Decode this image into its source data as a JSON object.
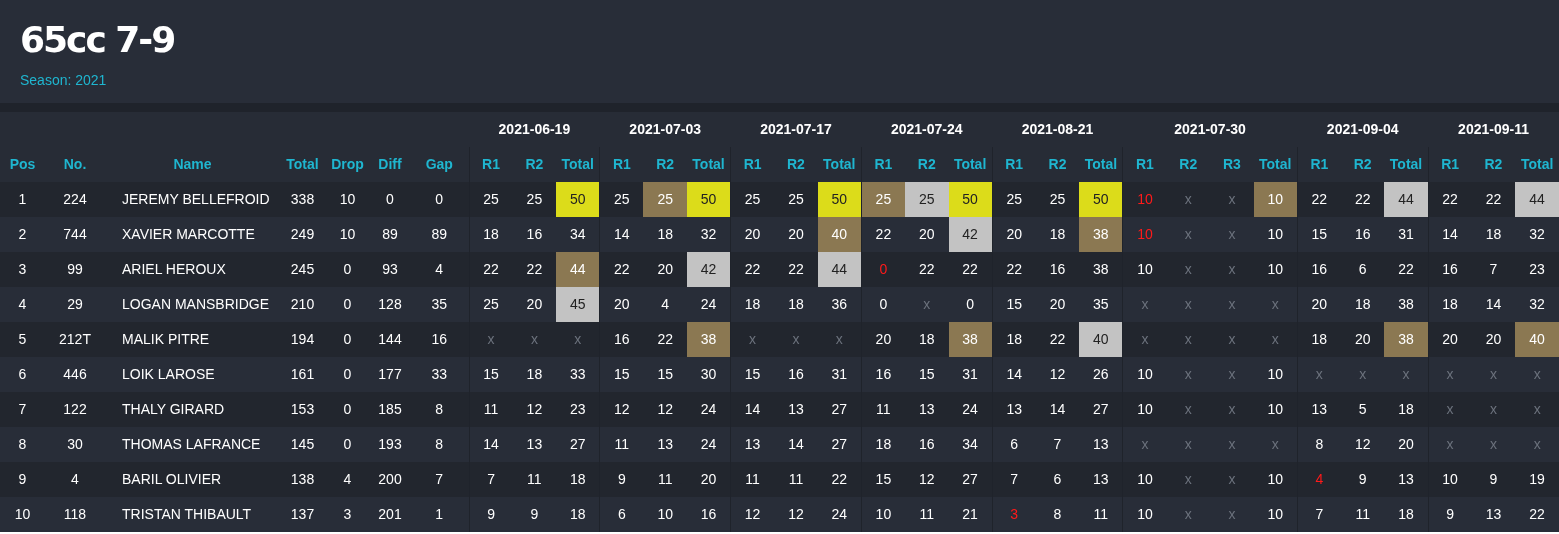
{
  "title": "65cc 7-9",
  "season": "Season: 2021",
  "columns": [
    "Pos",
    "No.",
    "Name",
    "Total",
    "Drop",
    "Diff",
    "Gap"
  ],
  "events": [
    {
      "date": "2021-06-19",
      "columns": [
        "R1",
        "R2",
        "Total"
      ]
    },
    {
      "date": "2021-07-03",
      "columns": [
        "R1",
        "R2",
        "Total"
      ]
    },
    {
      "date": "2021-07-17",
      "columns": [
        "R1",
        "R2",
        "Total"
      ]
    },
    {
      "date": "2021-07-24",
      "columns": [
        "R1",
        "R2",
        "Total"
      ]
    },
    {
      "date": "2021-08-21",
      "columns": [
        "R1",
        "R2",
        "Total"
      ]
    },
    {
      "date": "2021-07-30",
      "columns": [
        "R1",
        "R2",
        "R3",
        "Total"
      ]
    },
    {
      "date": "2021-09-04",
      "columns": [
        "R1",
        "R2",
        "Total"
      ]
    },
    {
      "date": "2021-09-11",
      "columns": [
        "R1",
        "R2",
        "Total"
      ]
    }
  ],
  "rows": [
    {
      "cells": [
        "1",
        "224",
        "JEREMY BELLEFROID",
        "338",
        "10",
        "0",
        "0"
      ],
      "events": [
        [
          {
            "text": "25",
            "kind": "plain"
          },
          {
            "text": "25",
            "kind": "plain"
          },
          {
            "text": "50",
            "kind": "gold"
          }
        ],
        [
          {
            "text": "25",
            "kind": "plain"
          },
          {
            "text": "25",
            "kind": "bronze"
          },
          {
            "text": "50",
            "kind": "gold"
          }
        ],
        [
          {
            "text": "25",
            "kind": "plain"
          },
          {
            "text": "25",
            "kind": "plain"
          },
          {
            "text": "50",
            "kind": "gold"
          }
        ],
        [
          {
            "text": "25",
            "kind": "bronze"
          },
          {
            "text": "25",
            "kind": "silver"
          },
          {
            "text": "50",
            "kind": "gold"
          }
        ],
        [
          {
            "text": "25",
            "kind": "plain"
          },
          {
            "text": "25",
            "kind": "plain"
          },
          {
            "text": "50",
            "kind": "gold"
          }
        ],
        [
          {
            "text": "10",
            "kind": "flagged"
          },
          {
            "text": "x",
            "kind": "absent"
          },
          {
            "text": "x",
            "kind": "absent"
          },
          {
            "text": "10",
            "kind": "bronze"
          }
        ],
        [
          {
            "text": "22",
            "kind": "plain"
          },
          {
            "text": "22",
            "kind": "plain"
          },
          {
            "text": "44",
            "kind": "silver"
          }
        ],
        [
          {
            "text": "22",
            "kind": "plain"
          },
          {
            "text": "22",
            "kind": "plain"
          },
          {
            "text": "44",
            "kind": "silver"
          }
        ]
      ]
    },
    {
      "cells": [
        "2",
        "744",
        "XAVIER MARCOTTE",
        "249",
        "10",
        "89",
        "89"
      ],
      "events": [
        [
          {
            "text": "18",
            "kind": "plain"
          },
          {
            "text": "16",
            "kind": "plain"
          },
          {
            "text": "34",
            "kind": "plain"
          }
        ],
        [
          {
            "text": "14",
            "kind": "plain"
          },
          {
            "text": "18",
            "kind": "plain"
          },
          {
            "text": "32",
            "kind": "plain"
          }
        ],
        [
          {
            "text": "20",
            "kind": "plain"
          },
          {
            "text": "20",
            "kind": "plain"
          },
          {
            "text": "40",
            "kind": "bronze"
          }
        ],
        [
          {
            "text": "22",
            "kind": "plain"
          },
          {
            "text": "20",
            "kind": "plain"
          },
          {
            "text": "42",
            "kind": "silver"
          }
        ],
        [
          {
            "text": "20",
            "kind": "plain"
          },
          {
            "text": "18",
            "kind": "plain"
          },
          {
            "text": "38",
            "kind": "bronze"
          }
        ],
        [
          {
            "text": "10",
            "kind": "flagged"
          },
          {
            "text": "x",
            "kind": "absent"
          },
          {
            "text": "x",
            "kind": "absent"
          },
          {
            "text": "10",
            "kind": "plain"
          }
        ],
        [
          {
            "text": "15",
            "kind": "plain"
          },
          {
            "text": "16",
            "kind": "plain"
          },
          {
            "text": "31",
            "kind": "plain"
          }
        ],
        [
          {
            "text": "14",
            "kind": "plain"
          },
          {
            "text": "18",
            "kind": "plain"
          },
          {
            "text": "32",
            "kind": "plain"
          }
        ]
      ]
    },
    {
      "cells": [
        "3",
        "99",
        "ARIEL HEROUX",
        "245",
        "0",
        "93",
        "4"
      ],
      "events": [
        [
          {
            "text": "22",
            "kind": "plain"
          },
          {
            "text": "22",
            "kind": "plain"
          },
          {
            "text": "44",
            "kind": "bronze"
          }
        ],
        [
          {
            "text": "22",
            "kind": "plain"
          },
          {
            "text": "20",
            "kind": "plain"
          },
          {
            "text": "42",
            "kind": "silver"
          }
        ],
        [
          {
            "text": "22",
            "kind": "plain"
          },
          {
            "text": "22",
            "kind": "plain"
          },
          {
            "text": "44",
            "kind": "silver"
          }
        ],
        [
          {
            "text": "0",
            "kind": "flagged"
          },
          {
            "text": "22",
            "kind": "plain"
          },
          {
            "text": "22",
            "kind": "plain"
          }
        ],
        [
          {
            "text": "22",
            "kind": "plain"
          },
          {
            "text": "16",
            "kind": "plain"
          },
          {
            "text": "38",
            "kind": "plain"
          }
        ],
        [
          {
            "text": "10",
            "kind": "plain"
          },
          {
            "text": "x",
            "kind": "absent"
          },
          {
            "text": "x",
            "kind": "absent"
          },
          {
            "text": "10",
            "kind": "plain"
          }
        ],
        [
          {
            "text": "16",
            "kind": "plain"
          },
          {
            "text": "6",
            "kind": "plain"
          },
          {
            "text": "22",
            "kind": "plain"
          }
        ],
        [
          {
            "text": "16",
            "kind": "plain"
          },
          {
            "text": "7",
            "kind": "plain"
          },
          {
            "text": "23",
            "kind": "plain"
          }
        ]
      ]
    },
    {
      "cells": [
        "4",
        "29",
        "LOGAN MANSBRIDGE",
        "210",
        "0",
        "128",
        "35"
      ],
      "events": [
        [
          {
            "text": "25",
            "kind": "plain"
          },
          {
            "text": "20",
            "kind": "plain"
          },
          {
            "text": "45",
            "kind": "silver"
          }
        ],
        [
          {
            "text": "20",
            "kind": "plain"
          },
          {
            "text": "4",
            "kind": "plain"
          },
          {
            "text": "24",
            "kind": "plain"
          }
        ],
        [
          {
            "text": "18",
            "kind": "plain"
          },
          {
            "text": "18",
            "kind": "plain"
          },
          {
            "text": "36",
            "kind": "plain"
          }
        ],
        [
          {
            "text": "0",
            "kind": "plain"
          },
          {
            "text": "x",
            "kind": "absent"
          },
          {
            "text": "0",
            "kind": "plain"
          }
        ],
        [
          {
            "text": "15",
            "kind": "plain"
          },
          {
            "text": "20",
            "kind": "plain"
          },
          {
            "text": "35",
            "kind": "plain"
          }
        ],
        [
          {
            "text": "x",
            "kind": "absent"
          },
          {
            "text": "x",
            "kind": "absent"
          },
          {
            "text": "x",
            "kind": "absent"
          },
          {
            "text": "x",
            "kind": "absent"
          }
        ],
        [
          {
            "text": "20",
            "kind": "plain"
          },
          {
            "text": "18",
            "kind": "plain"
          },
          {
            "text": "38",
            "kind": "plain"
          }
        ],
        [
          {
            "text": "18",
            "kind": "plain"
          },
          {
            "text": "14",
            "kind": "plain"
          },
          {
            "text": "32",
            "kind": "plain"
          }
        ]
      ]
    },
    {
      "cells": [
        "5",
        "212T",
        "MALIK PITRE",
        "194",
        "0",
        "144",
        "16"
      ],
      "events": [
        [
          {
            "text": "x",
            "kind": "absent"
          },
          {
            "text": "x",
            "kind": "absent"
          },
          {
            "text": "x",
            "kind": "absent"
          }
        ],
        [
          {
            "text": "16",
            "kind": "plain"
          },
          {
            "text": "22",
            "kind": "plain"
          },
          {
            "text": "38",
            "kind": "bronze"
          }
        ],
        [
          {
            "text": "x",
            "kind": "absent"
          },
          {
            "text": "x",
            "kind": "absent"
          },
          {
            "text": "x",
            "kind": "absent"
          }
        ],
        [
          {
            "text": "20",
            "kind": "plain"
          },
          {
            "text": "18",
            "kind": "plain"
          },
          {
            "text": "38",
            "kind": "bronze"
          }
        ],
        [
          {
            "text": "18",
            "kind": "plain"
          },
          {
            "text": "22",
            "kind": "plain"
          },
          {
            "text": "40",
            "kind": "silver"
          }
        ],
        [
          {
            "text": "x",
            "kind": "absent"
          },
          {
            "text": "x",
            "kind": "absent"
          },
          {
            "text": "x",
            "kind": "absent"
          },
          {
            "text": "x",
            "kind": "absent"
          }
        ],
        [
          {
            "text": "18",
            "kind": "plain"
          },
          {
            "text": "20",
            "kind": "plain"
          },
          {
            "text": "38",
            "kind": "bronze"
          }
        ],
        [
          {
            "text": "20",
            "kind": "plain"
          },
          {
            "text": "20",
            "kind": "plain"
          },
          {
            "text": "40",
            "kind": "bronze"
          }
        ]
      ]
    },
    {
      "cells": [
        "6",
        "446",
        "LOIK LAROSE",
        "161",
        "0",
        "177",
        "33"
      ],
      "events": [
        [
          {
            "text": "15",
            "kind": "plain"
          },
          {
            "text": "18",
            "kind": "plain"
          },
          {
            "text": "33",
            "kind": "plain"
          }
        ],
        [
          {
            "text": "15",
            "kind": "plain"
          },
          {
            "text": "15",
            "kind": "plain"
          },
          {
            "text": "30",
            "kind": "plain"
          }
        ],
        [
          {
            "text": "15",
            "kind": "plain"
          },
          {
            "text": "16",
            "kind": "plain"
          },
          {
            "text": "31",
            "kind": "plain"
          }
        ],
        [
          {
            "text": "16",
            "kind": "plain"
          },
          {
            "text": "15",
            "kind": "plain"
          },
          {
            "text": "31",
            "kind": "plain"
          }
        ],
        [
          {
            "text": "14",
            "kind": "plain"
          },
          {
            "text": "12",
            "kind": "plain"
          },
          {
            "text": "26",
            "kind": "plain"
          }
        ],
        [
          {
            "text": "10",
            "kind": "plain"
          },
          {
            "text": "x",
            "kind": "absent"
          },
          {
            "text": "x",
            "kind": "absent"
          },
          {
            "text": "10",
            "kind": "plain"
          }
        ],
        [
          {
            "text": "x",
            "kind": "absent"
          },
          {
            "text": "x",
            "kind": "absent"
          },
          {
            "text": "x",
            "kind": "absent"
          }
        ],
        [
          {
            "text": "x",
            "kind": "absent"
          },
          {
            "text": "x",
            "kind": "absent"
          },
          {
            "text": "x",
            "kind": "absent"
          }
        ]
      ]
    },
    {
      "cells": [
        "7",
        "122",
        "THALY GIRARD",
        "153",
        "0",
        "185",
        "8"
      ],
      "events": [
        [
          {
            "text": "11",
            "kind": "plain"
          },
          {
            "text": "12",
            "kind": "plain"
          },
          {
            "text": "23",
            "kind": "plain"
          }
        ],
        [
          {
            "text": "12",
            "kind": "plain"
          },
          {
            "text": "12",
            "kind": "plain"
          },
          {
            "text": "24",
            "kind": "plain"
          }
        ],
        [
          {
            "text": "14",
            "kind": "plain"
          },
          {
            "text": "13",
            "kind": "plain"
          },
          {
            "text": "27",
            "kind": "plain"
          }
        ],
        [
          {
            "text": "11",
            "kind": "plain"
          },
          {
            "text": "13",
            "kind": "plain"
          },
          {
            "text": "24",
            "kind": "plain"
          }
        ],
        [
          {
            "text": "13",
            "kind": "plain"
          },
          {
            "text": "14",
            "kind": "plain"
          },
          {
            "text": "27",
            "kind": "plain"
          }
        ],
        [
          {
            "text": "10",
            "kind": "plain"
          },
          {
            "text": "x",
            "kind": "absent"
          },
          {
            "text": "x",
            "kind": "absent"
          },
          {
            "text": "10",
            "kind": "plain"
          }
        ],
        [
          {
            "text": "13",
            "kind": "plain"
          },
          {
            "text": "5",
            "kind": "plain"
          },
          {
            "text": "18",
            "kind": "plain"
          }
        ],
        [
          {
            "text": "x",
            "kind": "absent"
          },
          {
            "text": "x",
            "kind": "absent"
          },
          {
            "text": "x",
            "kind": "absent"
          }
        ]
      ]
    },
    {
      "cells": [
        "8",
        "30",
        "THOMAS LAFRANCE",
        "145",
        "0",
        "193",
        "8"
      ],
      "events": [
        [
          {
            "text": "14",
            "kind": "plain"
          },
          {
            "text": "13",
            "kind": "plain"
          },
          {
            "text": "27",
            "kind": "plain"
          }
        ],
        [
          {
            "text": "11",
            "kind": "plain"
          },
          {
            "text": "13",
            "kind": "plain"
          },
          {
            "text": "24",
            "kind": "plain"
          }
        ],
        [
          {
            "text": "13",
            "kind": "plain"
          },
          {
            "text": "14",
            "kind": "plain"
          },
          {
            "text": "27",
            "kind": "plain"
          }
        ],
        [
          {
            "text": "18",
            "kind": "plain"
          },
          {
            "text": "16",
            "kind": "plain"
          },
          {
            "text": "34",
            "kind": "plain"
          }
        ],
        [
          {
            "text": "6",
            "kind": "plain"
          },
          {
            "text": "7",
            "kind": "plain"
          },
          {
            "text": "13",
            "kind": "plain"
          }
        ],
        [
          {
            "text": "x",
            "kind": "absent"
          },
          {
            "text": "x",
            "kind": "absent"
          },
          {
            "text": "x",
            "kind": "absent"
          },
          {
            "text": "x",
            "kind": "absent"
          }
        ],
        [
          {
            "text": "8",
            "kind": "plain"
          },
          {
            "text": "12",
            "kind": "plain"
          },
          {
            "text": "20",
            "kind": "plain"
          }
        ],
        [
          {
            "text": "x",
            "kind": "absent"
          },
          {
            "text": "x",
            "kind": "absent"
          },
          {
            "text": "x",
            "kind": "absent"
          }
        ]
      ]
    },
    {
      "cells": [
        "9",
        "4",
        "BARIL OLIVIER",
        "138",
        "4",
        "200",
        "7"
      ],
      "events": [
        [
          {
            "text": "7",
            "kind": "plain"
          },
          {
            "text": "11",
            "kind": "plain"
          },
          {
            "text": "18",
            "kind": "plain"
          }
        ],
        [
          {
            "text": "9",
            "kind": "plain"
          },
          {
            "text": "11",
            "kind": "plain"
          },
          {
            "text": "20",
            "kind": "plain"
          }
        ],
        [
          {
            "text": "11",
            "kind": "plain"
          },
          {
            "text": "11",
            "kind": "plain"
          },
          {
            "text": "22",
            "kind": "plain"
          }
        ],
        [
          {
            "text": "15",
            "kind": "plain"
          },
          {
            "text": "12",
            "kind": "plain"
          },
          {
            "text": "27",
            "kind": "plain"
          }
        ],
        [
          {
            "text": "7",
            "kind": "plain"
          },
          {
            "text": "6",
            "kind": "plain"
          },
          {
            "text": "13",
            "kind": "plain"
          }
        ],
        [
          {
            "text": "10",
            "kind": "plain"
          },
          {
            "text": "x",
            "kind": "absent"
          },
          {
            "text": "x",
            "kind": "absent"
          },
          {
            "text": "10",
            "kind": "plain"
          }
        ],
        [
          {
            "text": "4",
            "kind": "flagged"
          },
          {
            "text": "9",
            "kind": "plain"
          },
          {
            "text": "13",
            "kind": "plain"
          }
        ],
        [
          {
            "text": "10",
            "kind": "plain"
          },
          {
            "text": "9",
            "kind": "plain"
          },
          {
            "text": "19",
            "kind": "plain"
          }
        ]
      ]
    },
    {
      "cells": [
        "10",
        "118",
        "TRISTAN THIBAULT",
        "137",
        "3",
        "201",
        "1"
      ],
      "events": [
        [
          {
            "text": "9",
            "kind": "plain"
          },
          {
            "text": "9",
            "kind": "plain"
          },
          {
            "text": "18",
            "kind": "plain"
          }
        ],
        [
          {
            "text": "6",
            "kind": "plain"
          },
          {
            "text": "10",
            "kind": "plain"
          },
          {
            "text": "16",
            "kind": "plain"
          }
        ],
        [
          {
            "text": "12",
            "kind": "plain"
          },
          {
            "text": "12",
            "kind": "plain"
          },
          {
            "text": "24",
            "kind": "plain"
          }
        ],
        [
          {
            "text": "10",
            "kind": "plain"
          },
          {
            "text": "11",
            "kind": "plain"
          },
          {
            "text": "21",
            "kind": "plain"
          }
        ],
        [
          {
            "text": "3",
            "kind": "flagged"
          },
          {
            "text": "8",
            "kind": "plain"
          },
          {
            "text": "11",
            "kind": "plain"
          }
        ],
        [
          {
            "text": "10",
            "kind": "plain"
          },
          {
            "text": "x",
            "kind": "absent"
          },
          {
            "text": "x",
            "kind": "absent"
          },
          {
            "text": "10",
            "kind": "plain"
          }
        ],
        [
          {
            "text": "7",
            "kind": "plain"
          },
          {
            "text": "11",
            "kind": "plain"
          },
          {
            "text": "18",
            "kind": "plain"
          }
        ],
        [
          {
            "text": "9",
            "kind": "plain"
          },
          {
            "text": "13",
            "kind": "plain"
          },
          {
            "text": "22",
            "kind": "plain"
          }
        ]
      ]
    }
  ]
}
